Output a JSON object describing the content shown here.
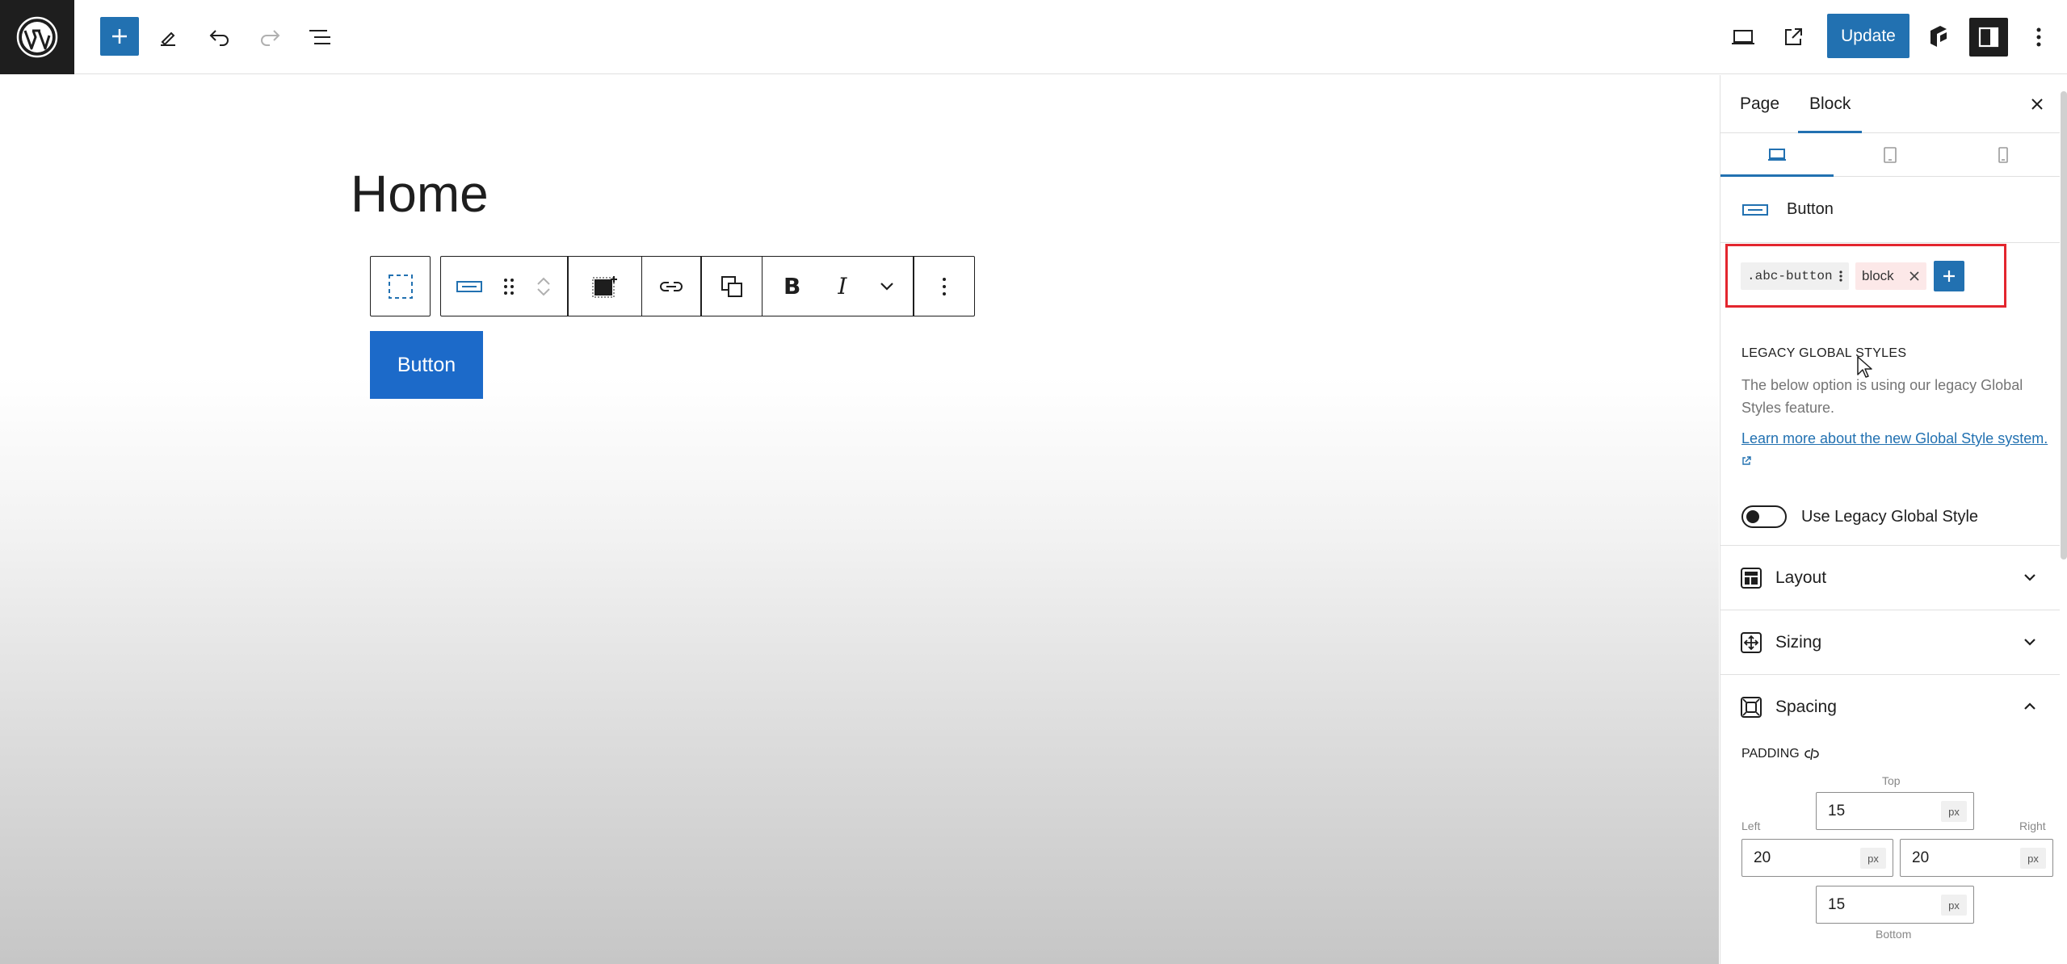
{
  "toolbar": {
    "update_label": "Update"
  },
  "canvas": {
    "page_title": "Home",
    "button_label": "Button",
    "block_toolbar": {
      "bold_label": "B",
      "italic_label": "I"
    }
  },
  "sidebar": {
    "tabs": [
      {
        "label": "Page",
        "active": false
      },
      {
        "label": "Block",
        "active": true
      }
    ],
    "block_name": "Button",
    "classes": [
      {
        "name": ".abc-button"
      },
      {
        "name": "block"
      }
    ],
    "legacy": {
      "heading": "LEGACY GLOBAL STYLES",
      "description": "The below option is using our legacy Global Styles feature.",
      "link": "Learn more about the new Global Style system.",
      "toggle_label": "Use Legacy Global Style",
      "toggle_on": false
    },
    "panels": [
      {
        "title": "Layout",
        "expanded": false
      },
      {
        "title": "Sizing",
        "expanded": false
      },
      {
        "title": "Spacing",
        "expanded": true
      }
    ],
    "padding": {
      "heading": "PADDING",
      "top": {
        "label": "Top",
        "value": "15",
        "unit": "px"
      },
      "left": {
        "label": "Left",
        "value": "20",
        "unit": "px"
      },
      "right": {
        "label": "Right",
        "value": "20",
        "unit": "px"
      },
      "bottom": {
        "label": "Bottom",
        "value": "15",
        "unit": "px"
      }
    }
  },
  "colors": {
    "accent": "#2271b1",
    "button_bg": "#1c6ac9",
    "highlight_border": "#e3262e",
    "dark": "#1e1e1e"
  }
}
